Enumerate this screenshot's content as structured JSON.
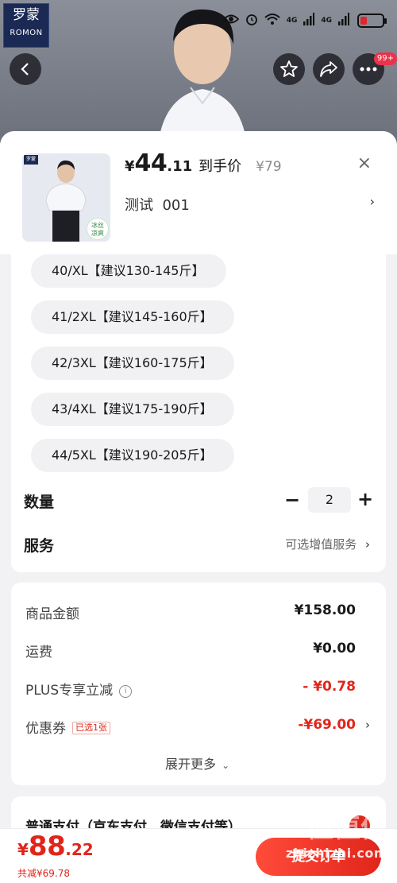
{
  "brand": {
    "logo_cn": "罗蒙",
    "logo_en": "ROMON"
  },
  "status_bar": {
    "signal_1": "4G",
    "signal_2": "4G"
  },
  "nav": {
    "notification_count": "99+"
  },
  "product": {
    "currency": "¥",
    "price_int": "44",
    "price_dec": ".11",
    "price_label": "到手价",
    "original_price": "¥79",
    "variant_label": "测试  001",
    "thumb_logo": "罗蒙",
    "thumb_tag": "冰丝 凉爽",
    "close_symbol": "×"
  },
  "sizes": [
    "40/XL【建议130-145斤】",
    "41/2XL【建议145-160斤】",
    "42/3XL【建议160-175斤】",
    "43/4XL【建议175-190斤】",
    "44/5XL【建议190-205斤】"
  ],
  "quantity": {
    "label": "数量",
    "value": "2",
    "minus": "−",
    "plus": "+"
  },
  "service": {
    "label": "服务",
    "option": "可选增值服务"
  },
  "summary": {
    "goods_label": "商品金额",
    "goods_value": "¥158.00",
    "shipping_label": "运费",
    "shipping_value": "¥0.00",
    "plus_label": "PLUS专享立减",
    "plus_value": "- ¥0.78",
    "coupon_label": "优惠券",
    "coupon_tag": "已选1张",
    "coupon_value": "-¥69.00",
    "expand_label": "展开更多"
  },
  "payment": {
    "title": "普通支付（京东支付、微信支付等）"
  },
  "bottom": {
    "currency": "¥",
    "total_int": "88",
    "total_dec": ".22",
    "saved": "共减¥69.78",
    "submit_label": "提交订单"
  },
  "watermark": {
    "text": "值值值",
    "url": "zhizhizhi.com"
  }
}
